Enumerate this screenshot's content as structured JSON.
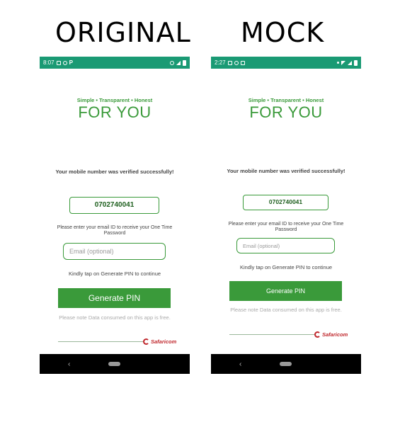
{
  "headings": {
    "original": "ORIGINAL",
    "mock": "MOCK"
  },
  "original": {
    "status": {
      "time": "8:07",
      "left_icons": [
        "image-icon",
        "whatsapp-icon",
        "p-icon"
      ],
      "right_icons": [
        "alarm-icon",
        "signal-icon",
        "battery-icon"
      ],
      "bar_color": "#1a9a74"
    },
    "tagline": "Simple • Transparent • Honest",
    "for_you": "FOR YOU",
    "verified_text": "Your mobile number was  verified successfully!",
    "phone_number": "0702740041",
    "email_info": "Please enter your email ID to receive your One Time Password",
    "email_placeholder": "Email (optional)",
    "kindly_text": "Kindly tap on Generate PIN to continue",
    "generate_label": "Generate PIN",
    "note_text": "Please note Data consumed on this app is free.",
    "brand": "Safaricom"
  },
  "mock": {
    "status": {
      "time": "2:27",
      "left_icons": [
        "image-icon",
        "whatsapp-icon",
        "youtube-icon"
      ],
      "right_icons": [
        "dot-icon",
        "wifi-icon",
        "signal-icon",
        "battery-icon"
      ],
      "bar_color": "#1a9a74"
    },
    "tagline": "Simple • Transparent • Honest",
    "for_you": "FOR YOU",
    "verified_text": "Your mobile number was  verified successfully!",
    "phone_number": "0702740041",
    "email_info": "Please enter your email ID to receive your One Time Password",
    "email_placeholder": "Email (optional)",
    "kindly_text": "Kindly tap on Generate PIN to continue",
    "generate_label": "Generate PIN",
    "note_text": "Please note Data consumed on this app is free.",
    "brand": "Safaricom"
  },
  "colors": {
    "accent": "#3a9a3a",
    "status_bar": "#1a9a74",
    "brand_red": "#c0282d"
  }
}
